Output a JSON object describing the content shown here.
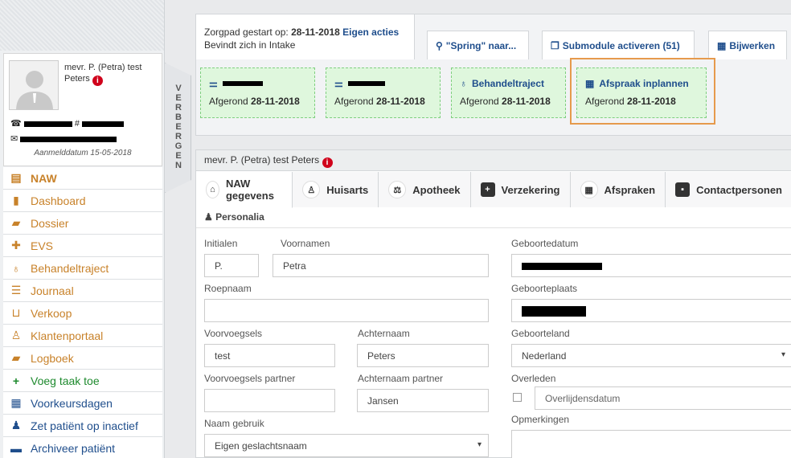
{
  "profile": {
    "name": "mevr. P. (Petra) test Peters",
    "aanmelddatum": "Aanmelddatum 15-05-2018"
  },
  "hide_panel_label": "VERBERGEN",
  "menu": [
    {
      "label": "NAW",
      "icon": "id-card-icon",
      "active": true
    },
    {
      "label": "Dashboard",
      "icon": "bookmark-icon"
    },
    {
      "label": "Dossier",
      "icon": "folder-icon"
    },
    {
      "label": "EVS",
      "icon": "medkit-icon"
    },
    {
      "label": "Behandeltraject",
      "icon": "stethoscope-icon"
    },
    {
      "label": "Journaal",
      "icon": "list-icon"
    },
    {
      "label": "Verkoop",
      "icon": "basket-icon"
    },
    {
      "label": "Klantenportaal",
      "icon": "user-md-icon"
    },
    {
      "label": "Logboek",
      "icon": "book-icon"
    },
    {
      "label": "Voeg taak toe",
      "icon": "plus-icon"
    },
    {
      "label": "Voorkeursdagen",
      "icon": "calendar-icon"
    },
    {
      "label": "Zet patiënt op inactief",
      "icon": "user-times-icon"
    },
    {
      "label": "Archiveer patiënt",
      "icon": "archive-icon"
    }
  ],
  "zorgpad": {
    "line1_label": "Zorgpad gestart op:",
    "start_date": "28-11-2018",
    "eigen_acties": "Eigen acties",
    "line2": "Bevindt zich in Intake"
  },
  "top_tabs": {
    "spring": "\"Spring\" naar...",
    "submodule": "Submodule activeren (51)",
    "bijwerken": "Bijwerken"
  },
  "steps": [
    {
      "afgerond": "Afgerond",
      "date": "28-11-2018"
    },
    {
      "afgerond": "Afgerond",
      "date": "28-11-2018"
    },
    {
      "title": "Behandeltraject",
      "afgerond": "Afgerond",
      "date": "28-11-2018"
    },
    {
      "title": "Afspraak inplannen",
      "afgerond": "Afgerond",
      "date": "28-11-2018"
    }
  ],
  "patient_header": "mevr. P. (Petra) test Peters",
  "main_tabs": [
    "NAW gegevens",
    "Huisarts",
    "Apotheek",
    "Verzekering",
    "Afspraken",
    "Contactpersonen"
  ],
  "section_title": "Personalia",
  "form": {
    "initialen_label": "Initialen",
    "initialen": "P.",
    "voornamen_label": "Voornamen",
    "voornamen": "Petra",
    "roepnaam_label": "Roepnaam",
    "roepnaam": "",
    "voorvoegsels_label": "Voorvoegsels",
    "voorvoegsels": "test",
    "achternaam_label": "Achternaam",
    "achternaam": "Peters",
    "vv_partner_label": "Voorvoegsels partner",
    "vv_partner": "",
    "an_partner_label": "Achternaam partner",
    "an_partner": "Jansen",
    "naam_gebruik_label": "Naam gebruik",
    "naam_gebruik": "Eigen geslachtsnaam",
    "geboortedatum_label": "Geboortedatum",
    "geboorteplaats_label": "Geboorteplaats",
    "geboorteland_label": "Geboorteland",
    "geboorteland": "Nederland",
    "overleden_label": "Overleden",
    "overlijdensdatum_placeholder": "Overlijdensdatum",
    "opmerkingen_label": "Opmerkingen"
  }
}
